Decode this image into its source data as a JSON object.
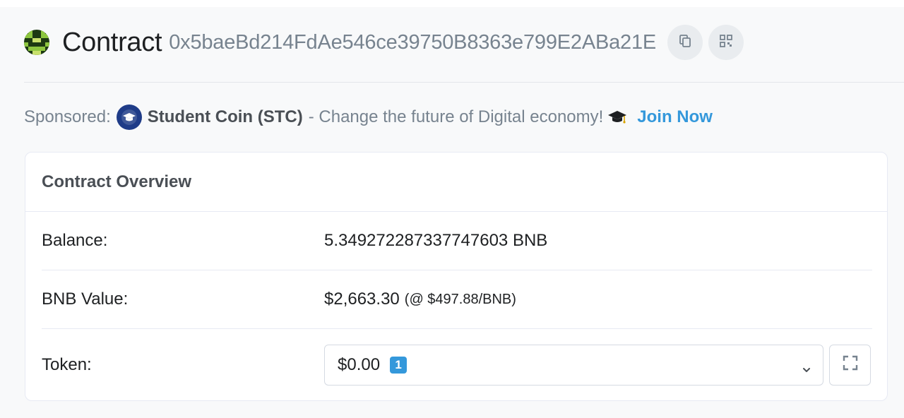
{
  "header": {
    "title": "Contract",
    "address": "0x5baeBd214FdAe546ce39750B8363e799E2ABa21E",
    "icons": [
      "blockie-avatar-icon",
      "copy-icon",
      "qr-code-icon"
    ]
  },
  "sponsored": {
    "label": "Sponsored:",
    "name": "Student Coin (STC)",
    "text": "- Change the future of Digital economy!",
    "cta": "Join Now",
    "icons": [
      "student-coin-logo-icon",
      "graduation-cap-icon"
    ]
  },
  "overview": {
    "title": "Contract Overview",
    "balance_label": "Balance:",
    "balance_value": "5.349272287337747603 BNB",
    "value_label": "BNB Value:",
    "value_amount": "$2,663.30",
    "value_rate": "(@ $497.88/BNB)",
    "token_label": "Token:",
    "token_value": "$0.00",
    "token_count": "1",
    "icons": [
      "chevron-down-icon",
      "expand-icon"
    ]
  },
  "colors": {
    "accent": "#3498db",
    "muted": "#77838f",
    "text": "#1e2022",
    "blockie_green": "#8dc63f"
  }
}
